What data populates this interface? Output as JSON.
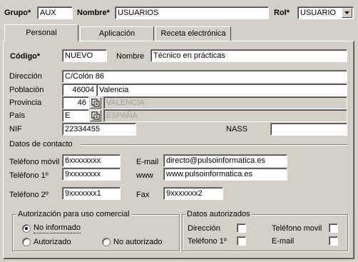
{
  "header": {
    "grupo_label": "Grupo*",
    "grupo_value": "AUX",
    "nombre_label": "Nombre*",
    "nombre_value": "USUARIOS",
    "rol_label": "Rol*",
    "rol_value": "USUARIO"
  },
  "tabs": [
    {
      "label": "Personal",
      "active": true
    },
    {
      "label": "Aplicación",
      "active": false
    },
    {
      "label": "Receta electrónica",
      "active": false
    }
  ],
  "personal": {
    "codigo_label": "Código*",
    "codigo_value": "NUEVO",
    "nombre_label": "Nombre",
    "nombre_value": "Técnico en prácticas",
    "direccion_label": "Dirección",
    "direccion_value": "C/Colón 86",
    "poblacion_label": "Población",
    "poblacion_cp": "46004",
    "poblacion_value": "Valencia",
    "provincia_label": "Provincia",
    "provincia_code": "46",
    "provincia_value": "VALENCIA",
    "pais_label": "País",
    "pais_code": "E",
    "pais_value": "ESPAÑA",
    "nif_label": "NIF",
    "nif_value": "22334455",
    "nass_label": "NASS",
    "nass_value": ""
  },
  "contacto": {
    "section_label": "Datos de contacto",
    "movil_label": "Teléfono móvil",
    "movil_value": "6xxxxxxxx",
    "email_label": "E-mail",
    "email_value": "directo@pulsoinformatica.es",
    "tel1_label": "Teléfono 1º",
    "tel1_value": "9xxxxxxxx",
    "www_label": "www",
    "www_value": "www.pulsoinformatica.es",
    "tel2_label": "Teléfono 2º",
    "tel2_value": "9xxxxxxx1",
    "fax_label": "Fax",
    "fax_value": "9xxxxxxx2"
  },
  "autorizacion": {
    "title": "Autorización para uso comercial",
    "option_no_informado": "No informado",
    "option_autorizado": "Autorizado",
    "option_no_autorizado": "No autorizado",
    "selected": "No informado"
  },
  "datos_autorizados": {
    "title": "Datos autorizados",
    "direccion": "Dirección",
    "telefono1": "Teléfono 1º",
    "telefono_movil": "Teléfono movil",
    "email": "E-mail"
  },
  "icons": {
    "lookup": "lookup-icon",
    "dropdown": "chevron-down-icon"
  }
}
